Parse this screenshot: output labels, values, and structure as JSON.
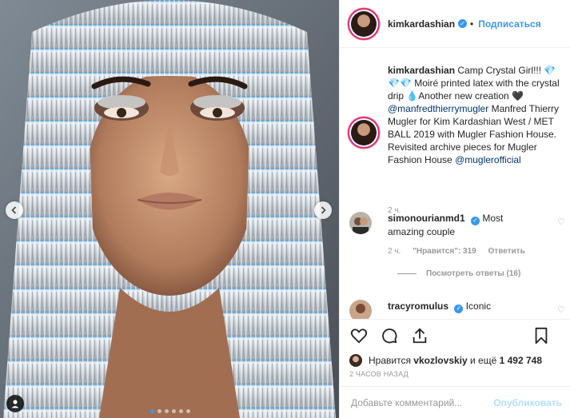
{
  "post": {
    "username": "kimkardashian",
    "follow_label": "Подписаться",
    "dot_separator": "•"
  },
  "caption": {
    "username": "kimkardashian",
    "text_1": "Camp Crystal Girl!!! 💎💎💎 Moiré printed latex with the crystal drip 💧Another new creation 🖤",
    "mention_1": "@manfredthierrymugler",
    "text_2": "Manfred Thierry Mugler for Kim Kardashian West / MET BALL 2019 with Mugler Fashion House. Revisited archive pieces for Mugler Fashion House",
    "mention_2": "@muglerofficial",
    "time": "2 ч."
  },
  "comments": [
    {
      "username": "simonourianmd1",
      "text": "Most amazing couple",
      "time": "2 ч.",
      "likes": "\"Нравится\": 319",
      "reply_label": "Ответить",
      "view_replies": "Посмотреть ответы (16)"
    },
    {
      "username": "tracyromulus",
      "text": "Iconic"
    }
  ],
  "likes_line": {
    "prefix": "Нравится",
    "user": "vkozlovskiy",
    "suffix": "и ещё",
    "count": "1 492 748"
  },
  "time_ago": "2 ЧАСОВ НАЗАД",
  "comment_input": {
    "placeholder": "Добавьте комментарий..."
  },
  "post_button": "Опубликовать",
  "carousel": {
    "total": 6,
    "active": 1
  },
  "icons": [
    "heart-icon",
    "comment-icon",
    "share-icon",
    "bookmark-icon",
    "verified-badge-icon",
    "user-tag-icon",
    "chevron-left-icon",
    "chevron-right-icon"
  ],
  "colors": {
    "link": "#3897f0",
    "mention": "#003569",
    "muted": "#999999",
    "border": "#efefef"
  }
}
